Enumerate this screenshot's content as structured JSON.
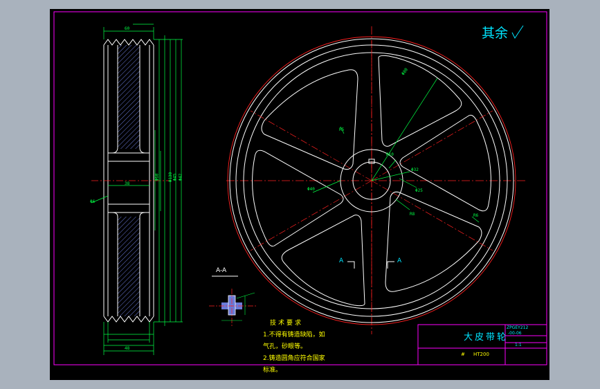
{
  "drawing": {
    "roughness_note": "其余",
    "section_label": "A-A",
    "section_markers": [
      "A",
      "A"
    ],
    "tech_requirements": {
      "title": "技术要求",
      "line1": "1.不得有铸造缺陷，如",
      "line2": "气孔，砂眼等。",
      "line3": "2.铸造圆角应符合国家",
      "line4": "标准。"
    },
    "title_block": {
      "part_name": "大皮带轮",
      "drawing_no": "ZPGEY212",
      "drawing_no_2": "-00-06",
      "scale_label": "1:1",
      "material_label": "#",
      "material_value": "HT200"
    },
    "dimensions": [
      "Φ130",
      "Φ60",
      "Φ45",
      "Φ42",
      "Φ80",
      "Φ40",
      "Φ32",
      "Φ25",
      "R5",
      "R6",
      "R8",
      "R10",
      "Φ6",
      "38",
      "48",
      "60"
    ]
  },
  "colors": {
    "background": "#000000",
    "frame": "#ff00ff",
    "outline": "#ffffff",
    "centerline": "#ff2020",
    "dimension": "#00ff44",
    "text_note": "#00e5ff",
    "hatch": "#6a7ad8"
  }
}
